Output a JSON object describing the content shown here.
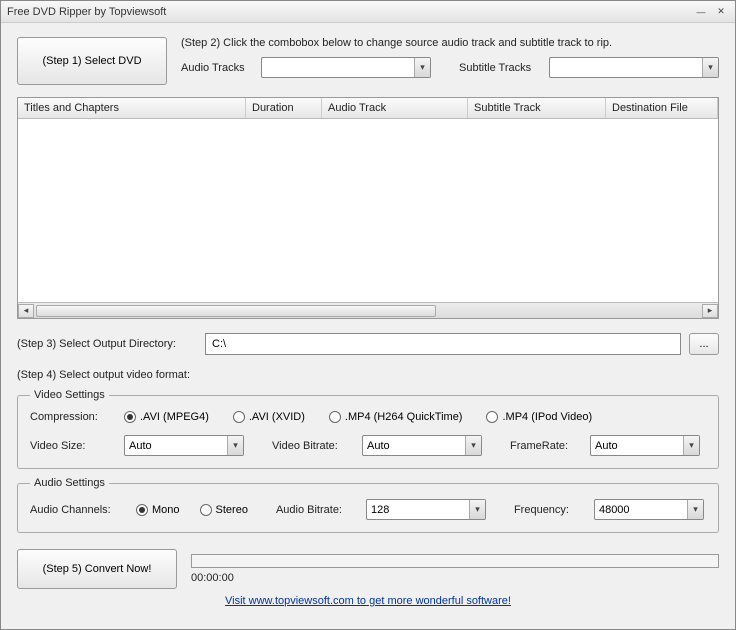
{
  "window": {
    "title": "Free DVD Ripper by Topviewsoft"
  },
  "step1": {
    "button": "(Step 1) Select DVD"
  },
  "step2": {
    "instruction": "(Step 2) Click the combobox below to change source audio track and subtitle track to rip.",
    "audio_label": "Audio Tracks",
    "audio_value": "",
    "subtitle_label": "Subtitle Tracks",
    "subtitle_value": ""
  },
  "table": {
    "headers": [
      "Titles and Chapters",
      "Duration",
      "Audio Track",
      "Subtitle Track",
      "Destination File"
    ]
  },
  "step3": {
    "label": "(Step 3) Select Output Directory:",
    "value": "C:\\",
    "browse": "..."
  },
  "step4": {
    "label": "(Step 4) Select output video format:"
  },
  "video": {
    "legend": "Video Settings",
    "compression_label": "Compression:",
    "options": [
      ".AVI (MPEG4)",
      ".AVI (XVID)",
      ".MP4 (H264 QuickTime)",
      ".MP4 (IPod Video)"
    ],
    "size_label": "Video Size:",
    "size_value": "Auto",
    "bitrate_label": "Video Bitrate:",
    "bitrate_value": "Auto",
    "framerate_label": "FrameRate:",
    "framerate_value": "Auto"
  },
  "audio": {
    "legend": "Audio Settings",
    "channels_label": "Audio Channels:",
    "mono": "Mono",
    "stereo": "Stereo",
    "bitrate_label": "Audio Bitrate:",
    "bitrate_value": "128",
    "frequency_label": "Frequency:",
    "frequency_value": "48000"
  },
  "step5": {
    "button": "(Step 5) Convert Now!",
    "time": "00:00:00"
  },
  "footer": {
    "link": "Visit www.topviewsoft.com to get more wonderful software!"
  }
}
